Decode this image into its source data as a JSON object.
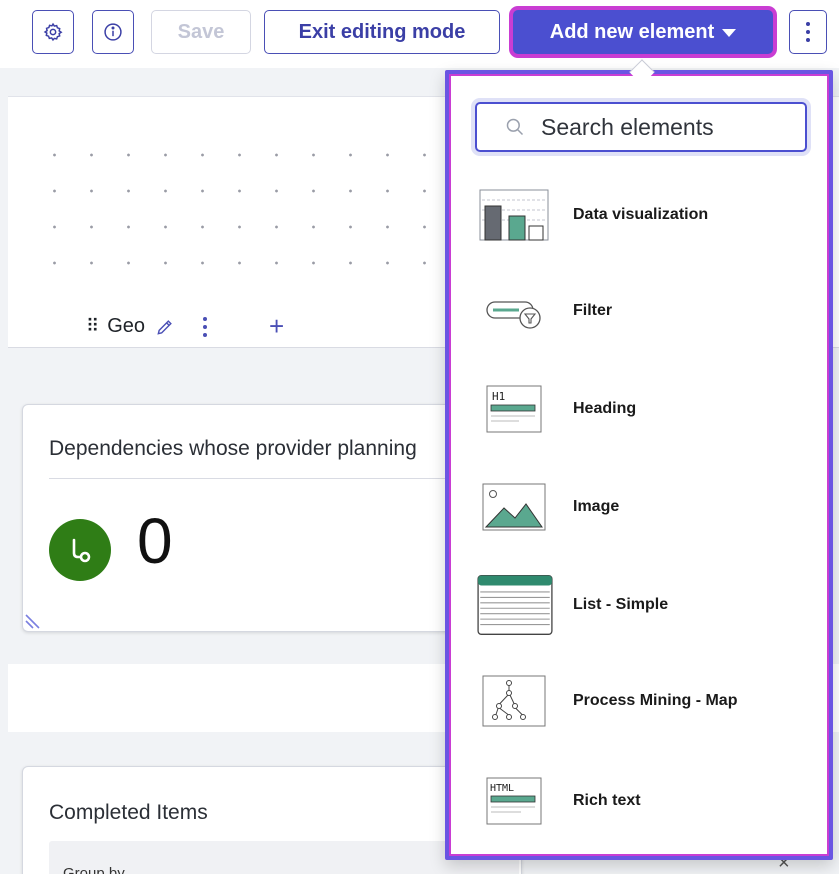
{
  "toolbar": {
    "save_label": "Save",
    "exit_label": "Exit editing mode",
    "add_label": "Add new element"
  },
  "canvas": {
    "section_title": "Geo"
  },
  "cards": {
    "dependencies": {
      "title": "Dependencies whose provider planning",
      "value": "0"
    },
    "completed": {
      "title": "Completed Items",
      "group_by_label": "Group by"
    }
  },
  "dropdown": {
    "search_placeholder": "Search elements",
    "items": [
      {
        "label": "Data visualization",
        "icon": "data-visualization-icon"
      },
      {
        "label": "Filter",
        "icon": "filter-icon"
      },
      {
        "label": "Heading",
        "icon": "heading-icon"
      },
      {
        "label": "Image",
        "icon": "image-icon"
      },
      {
        "label": "List - Simple",
        "icon": "list-icon"
      },
      {
        "label": "Process Mining - Map",
        "icon": "process-map-icon"
      },
      {
        "label": "Rich text",
        "icon": "rich-text-icon"
      }
    ]
  },
  "colors": {
    "accent": "#4b4fd0",
    "highlight_outline": "#c93dd3",
    "metric_green": "#2f7d16",
    "thumb_teal": "#5aa88f"
  }
}
